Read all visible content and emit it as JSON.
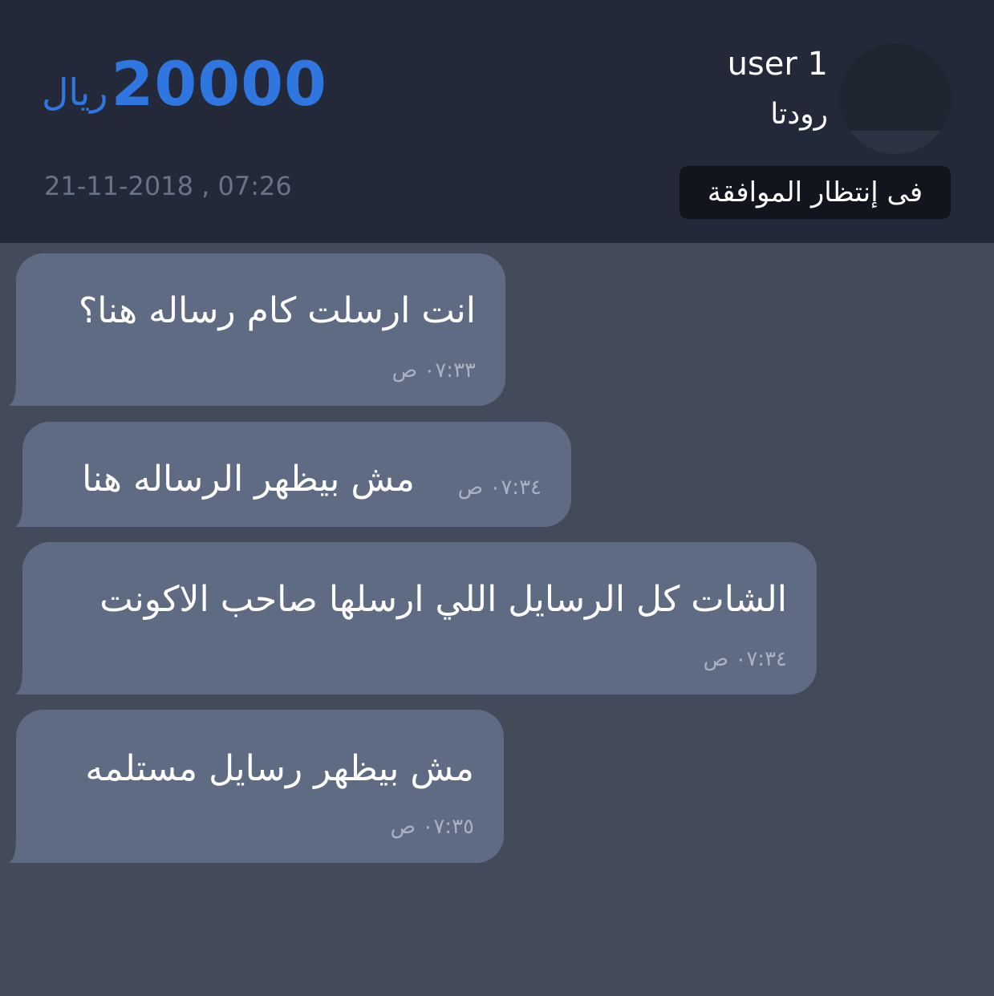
{
  "header": {
    "user_name": "user 1",
    "user_subtitle": "رودتا",
    "status": "فى إنتظار الموافقة",
    "price_amount": "20000",
    "price_currency": "ريال",
    "datetime": "21-11-2018 , 07:26",
    "accent_color": "#2f76e0"
  },
  "messages": [
    {
      "text": "انت ارسلت كام رساله هنا؟",
      "time": "٠٧:٣٣ ص"
    },
    {
      "text": "مش بيظهر الرساله هنا",
      "time": "٠٧:٣٤ ص"
    },
    {
      "text": "الشات كل الرسايل اللي ارسلها صاحب الاكونت",
      "time": "٠٧:٣٤ ص"
    },
    {
      "text": "مش بيظهر رسايل مستلمه",
      "time": "٠٧:٣٥ ص"
    }
  ]
}
